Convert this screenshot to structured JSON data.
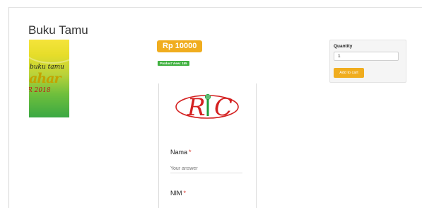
{
  "page": {
    "title": "Buku Tamu"
  },
  "product": {
    "image_text": {
      "line1": "buku tamu",
      "line2": "ahar",
      "line3": "R 2018"
    },
    "price": "Rp 10000",
    "views": "Product View: 155"
  },
  "form": {
    "fields": [
      {
        "label": "Nama",
        "required": "*",
        "placeholder": "Your answer"
      },
      {
        "label": "NIM",
        "required": "*"
      }
    ]
  },
  "cart": {
    "quantity_label": "Quantity",
    "quantity_value": "1",
    "add_button_label": "Add to cart"
  },
  "colors": {
    "accent_orange": "#f0ad1f",
    "view_badge_green": "#3eb03e",
    "logo_red": "#d42020",
    "logo_green": "#1e9e3a",
    "required_red": "#d93025"
  },
  "icons": [
    "ric-logo",
    "microphone-icon"
  ]
}
